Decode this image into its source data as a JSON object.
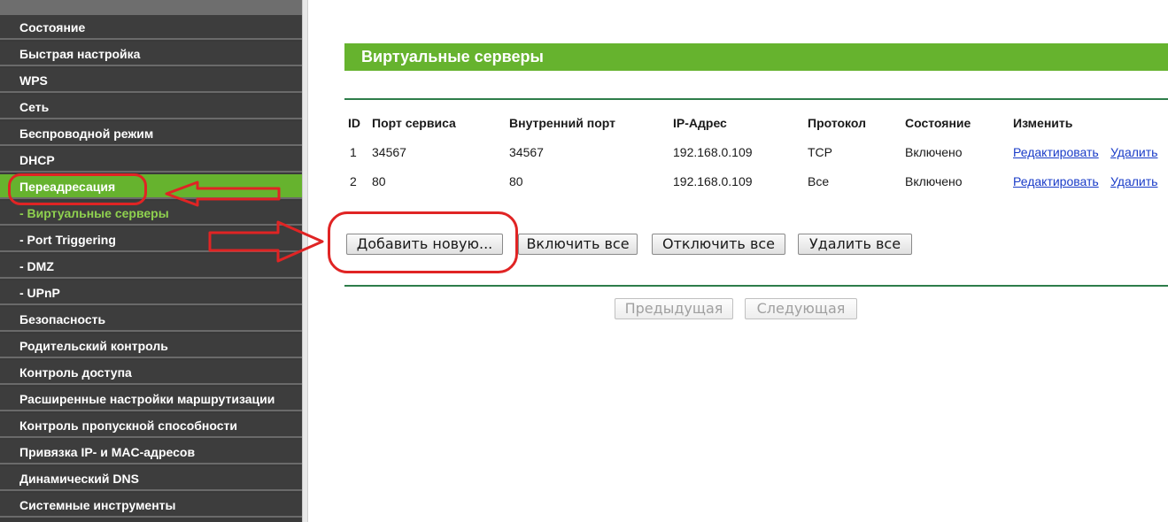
{
  "sidebar": {
    "items": [
      {
        "label": "Состояние"
      },
      {
        "label": "Быстрая настройка"
      },
      {
        "label": "WPS"
      },
      {
        "label": "Сеть"
      },
      {
        "label": "Беспроводной режим"
      },
      {
        "label": "DHCP"
      },
      {
        "label": "Переадресация"
      },
      {
        "label": "- Виртуальные серверы"
      },
      {
        "label": "- Port Triggering"
      },
      {
        "label": "- DMZ"
      },
      {
        "label": "- UPnP"
      },
      {
        "label": "Безопасность"
      },
      {
        "label": "Родительский контроль"
      },
      {
        "label": "Контроль доступа"
      },
      {
        "label": "Расширенные настройки маршрутизации"
      },
      {
        "label": "Контроль пропускной способности"
      },
      {
        "label": "Привязка IP- и MAC-адресов"
      },
      {
        "label": "Динамический DNS"
      },
      {
        "label": "Системные инструменты"
      }
    ]
  },
  "page": {
    "title": "Виртуальные серверы"
  },
  "table": {
    "headers": [
      "ID",
      "Порт сервиса",
      "Внутренний порт",
      "IP-Адрес",
      "Протокол",
      "Состояние",
      "Изменить"
    ],
    "rows": [
      {
        "id": "1",
        "service_port": "34567",
        "internal_port": "34567",
        "ip": "192.168.0.109",
        "protocol": "TCP",
        "status": "Включено",
        "edit": "Редактировать",
        "delete": "Удалить"
      },
      {
        "id": "2",
        "service_port": "80",
        "internal_port": "80",
        "ip": "192.168.0.109",
        "protocol": "Все",
        "status": "Включено",
        "edit": "Редактировать",
        "delete": "Удалить"
      }
    ]
  },
  "actions": {
    "add": "Добавить новую...",
    "enable_all": "Включить все",
    "disable_all": "Отключить все",
    "delete_all": "Удалить все"
  },
  "pagination": {
    "prev": "Предыдущая",
    "next": "Следующая"
  },
  "colors": {
    "accent": "#66b32e",
    "sidebar": "#3d3d3d",
    "annotation": "#e02424",
    "link": "#1a3cc8"
  }
}
